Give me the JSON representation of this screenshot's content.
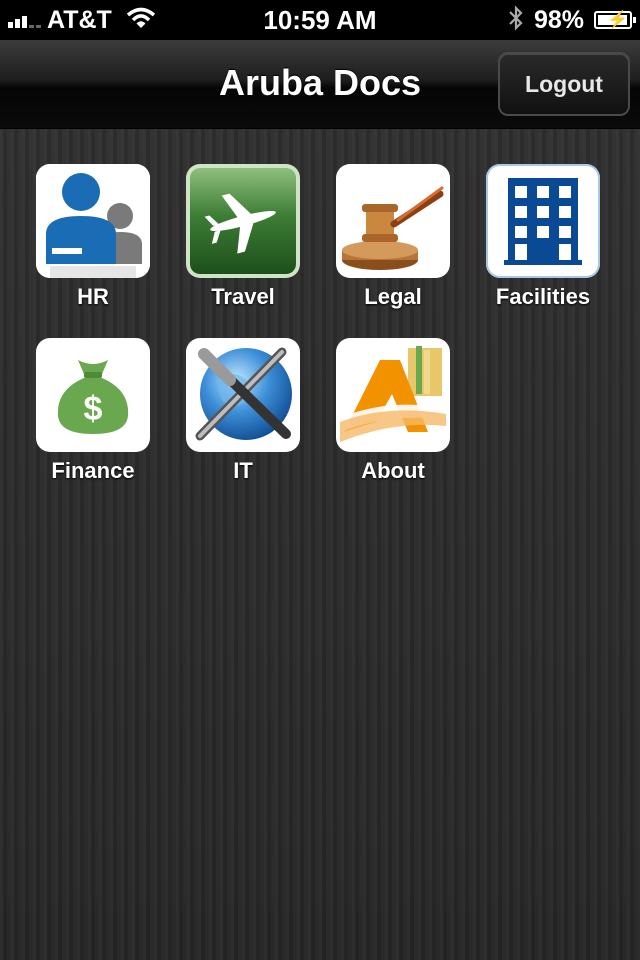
{
  "status_bar": {
    "carrier": "AT&T",
    "time": "10:59 AM",
    "battery_percent": "98%",
    "battery_level": 0.98
  },
  "nav": {
    "title": "Aruba Docs",
    "logout_label": "Logout"
  },
  "tiles": [
    {
      "label": "HR",
      "icon": "people-icon"
    },
    {
      "label": "Travel",
      "icon": "airplane-icon"
    },
    {
      "label": "Legal",
      "icon": "gavel-icon"
    },
    {
      "label": "Facilities",
      "icon": "building-icon"
    },
    {
      "label": "Finance",
      "icon": "money-bag-icon"
    },
    {
      "label": "IT",
      "icon": "globe-tools-icon"
    },
    {
      "label": "About",
      "icon": "aruba-logo-icon"
    }
  ],
  "colors": {
    "nav_bg": "#0a0a0a",
    "content_bg": "#2b2b2b",
    "hr_blue": "#1a6db5",
    "travel_green": "#2e6b2a",
    "facilities_blue": "#0a4a94",
    "finance_green": "#6aa84f",
    "about_orange": "#f39200"
  }
}
